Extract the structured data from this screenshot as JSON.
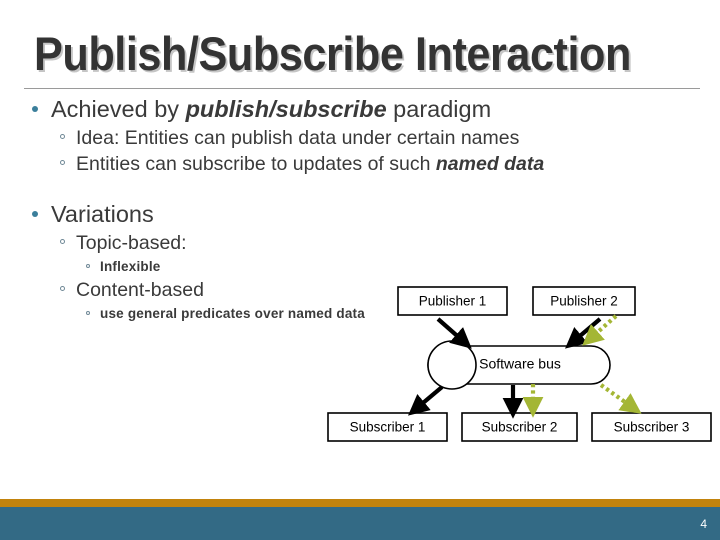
{
  "slide": {
    "title": "Publish/Subscribe Interaction",
    "page_number": "4",
    "accent_color": "#c2830c",
    "band_color": "#336a85",
    "bullet_color": "#3b7f9b",
    "title_color": "#333333"
  },
  "body": {
    "b1": {
      "pre": "Achieved by ",
      "em": "publish/subscribe",
      "post": " paradigm"
    },
    "b1_sub1": "Idea: Entities can publish data under certain names",
    "b1_sub2": {
      "pre": "Entities can subscribe to updates of such ",
      "em": "named data"
    },
    "b2": "Variations",
    "b2_sub1": "Topic-based:",
    "b2_sub1_sub1": "Inflexible",
    "b2_sub2": "Content-based",
    "b2_sub2_sub1": "use general predicates over named data"
  },
  "diagram": {
    "publisher_1": "Publisher 1",
    "publisher_2": "Publisher 2",
    "software_bus": "Software bus",
    "subscriber_1": "Subscriber 1",
    "subscriber_2": "Subscriber 2",
    "subscriber_3": "Subscriber 3",
    "flow_color_primary": "#000000",
    "flow_color_secondary": "#a4b635"
  }
}
